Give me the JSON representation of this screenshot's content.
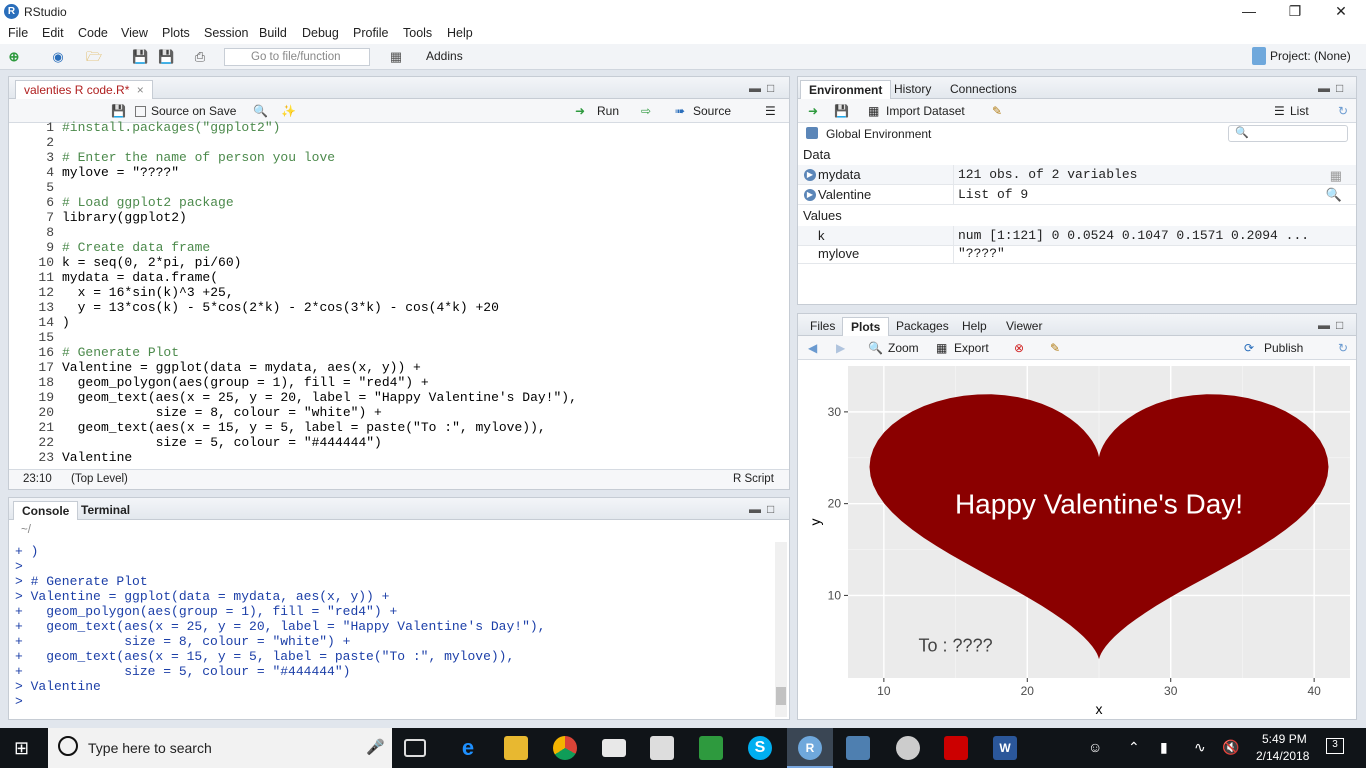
{
  "window": {
    "title": "RStudio",
    "app_icon_letter": "R"
  },
  "menu": [
    "File",
    "Edit",
    "Code",
    "View",
    "Plots",
    "Session",
    "Build",
    "Debug",
    "Profile",
    "Tools",
    "Help"
  ],
  "toolbar": {
    "goto_placeholder": "Go to file/function",
    "addins_label": "Addins",
    "project_label": "Project: (None)"
  },
  "editor": {
    "tab_label": "valenties R code.R*",
    "source_on_save_label": "Source on Save",
    "run_label": "Run",
    "source_label": "Source",
    "line_numbers": [
      "1",
      "2",
      "3",
      "4",
      "5",
      "6",
      "7",
      "8",
      "9",
      "10",
      "11",
      "12",
      "13",
      "14",
      "15",
      "16",
      "17",
      "18",
      "19",
      "20",
      "21",
      "22",
      "23"
    ],
    "lines": [
      "#install.packages(\"ggplot2\")",
      "",
      "# Enter the name of person you love",
      "mylove = \"????\"",
      "",
      "# Load ggplot2 package",
      "library(ggplot2)",
      "",
      "# Create data frame",
      "k = seq(0, 2*pi, pi/60)",
      "mydata = data.frame(",
      "  x = 16*sin(k)^3 +25,",
      "  y = 13*cos(k) - 5*cos(2*k) - 2*cos(3*k) - cos(4*k) +20",
      ")",
      "",
      "# Generate Plot",
      "Valentine = ggplot(data = mydata, aes(x, y)) +",
      "  geom_polygon(aes(group = 1), fill = \"red4\") +",
      "  geom_text(aes(x = 25, y = 20, label = \"Happy Valentine's Day!\"),",
      "            size = 8, colour = \"white\") +",
      "  geom_text(aes(x = 15, y = 5, label = paste(\"To :\", mylove)),",
      "            size = 5, colour = \"#444444\")",
      "Valentine"
    ],
    "status_position": "23:10",
    "status_scope": "(Top Level)",
    "status_type": "R Script"
  },
  "console": {
    "tabs": [
      "Console",
      "Terminal"
    ],
    "path": "~/",
    "lines": [
      "+ )",
      ">",
      "> # Generate Plot",
      "> Valentine = ggplot(data = mydata, aes(x, y)) +",
      "+   geom_polygon(aes(group = 1), fill = \"red4\") +",
      "+   geom_text(aes(x = 25, y = 20, label = \"Happy Valentine's Day!\"),",
      "+             size = 8, colour = \"white\") +",
      "+   geom_text(aes(x = 15, y = 5, label = paste(\"To :\", mylove)),",
      "+             size = 5, colour = \"#444444\")",
      "> Valentine",
      ">"
    ]
  },
  "environment": {
    "tabs": [
      "Environment",
      "History",
      "Connections"
    ],
    "import_label": "Import Dataset",
    "list_label": "List",
    "global_env_label": "Global Environment",
    "data_header": "Data",
    "values_header": "Values",
    "data_rows": [
      {
        "name": "mydata",
        "value": "121 obs. of 2 variables"
      },
      {
        "name": "Valentine",
        "value": "List of 9"
      }
    ],
    "value_rows": [
      {
        "name": "k",
        "value": "num [1:121] 0 0.0524 0.1047 0.1571 0.2094 ..."
      },
      {
        "name": "mylove",
        "value": "\"????\""
      }
    ]
  },
  "files_pane": {
    "tabs": [
      "Files",
      "Plots",
      "Packages",
      "Help",
      "Viewer"
    ],
    "zoom_label": "Zoom",
    "export_label": "Export",
    "publish_label": "Publish"
  },
  "chart_data": {
    "type": "area",
    "xlabel": "x",
    "ylabel": "y",
    "xlim": [
      7.5,
      42.5
    ],
    "ylim": [
      1,
      35
    ],
    "xticks": [
      10,
      20,
      30,
      40
    ],
    "yticks": [
      10,
      20,
      30
    ],
    "fill_color": "#8b0000",
    "panel_bg": "#ebebeb",
    "grid": true,
    "annotations": [
      {
        "x": 25,
        "y": 20,
        "text": "Happy Valentine's Day!",
        "color": "#ffffff"
      },
      {
        "x": 15,
        "y": 5,
        "text": "To : ????",
        "color": "#444444"
      }
    ],
    "series": [
      {
        "shape": "heart",
        "x_center": 25,
        "y_center": 20
      }
    ]
  },
  "taskbar": {
    "search_placeholder": "Type here to search",
    "time": "5:49 PM",
    "date": "2/14/2018",
    "notification_count": "3"
  }
}
